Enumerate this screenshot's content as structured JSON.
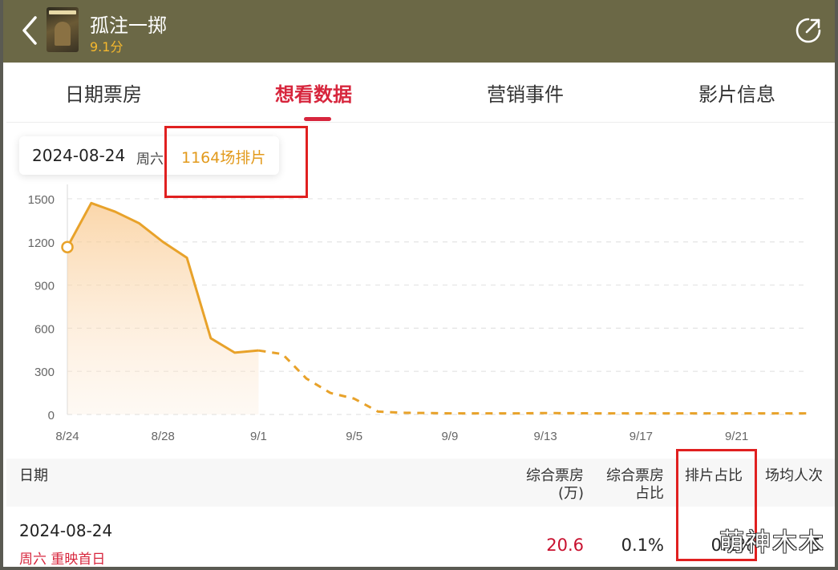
{
  "header": {
    "back_icon": "chevron-left-icon",
    "movie_title": "孤注一掷",
    "movie_score": "9.1分",
    "share_icon": "share-icon",
    "bg_color": "#6b6846",
    "score_color": "#f5b82e"
  },
  "tabs": [
    {
      "label": "日期票房",
      "active": false
    },
    {
      "label": "想看数据",
      "active": true
    },
    {
      "label": "营销事件",
      "active": false
    },
    {
      "label": "影片信息",
      "active": false
    }
  ],
  "tooltip": {
    "date": "2024-08-24",
    "weekday": "周六",
    "shows": "1164场排片"
  },
  "chart_data": {
    "type": "area",
    "title": "",
    "xlabel": "",
    "ylabel": "",
    "ylim": [
      0,
      1600
    ],
    "yticks": [
      0,
      300,
      600,
      900,
      1200,
      1500
    ],
    "x_tick_labels": [
      "8/24",
      "8/28",
      "9/1",
      "9/5",
      "9/9",
      "9/13",
      "9/17",
      "9/21"
    ],
    "x": [
      "8/24",
      "8/25",
      "8/26",
      "8/27",
      "8/28",
      "8/29",
      "8/30",
      "8/31",
      "9/1",
      "9/2",
      "9/3",
      "9/4",
      "9/5",
      "9/6",
      "9/7",
      "9/8",
      "9/9",
      "9/10",
      "9/11",
      "9/12",
      "9/13",
      "9/14",
      "9/15",
      "9/16",
      "9/17",
      "9/18",
      "9/19",
      "9/20",
      "9/21",
      "9/22",
      "9/23",
      "9/24"
    ],
    "series": [
      {
        "values": [
          1164,
          1470,
          1410,
          1330,
          1200,
          1090,
          530,
          430,
          445,
          420,
          250,
          150,
          110,
          20,
          12,
          10,
          8,
          8,
          8,
          8,
          10,
          9,
          8,
          8,
          8,
          8,
          8,
          8,
          8,
          8,
          8,
          8
        ],
        "actual_until": "9/1"
      }
    ],
    "selected_point": {
      "x": "8/24",
      "y": 1164
    },
    "grid": true,
    "line_color": "#e8a22a"
  },
  "table": {
    "headers": {
      "date": "日期",
      "box_office_line1": "综合票房",
      "box_office_line2": "(万)",
      "share_line1": "综合票房",
      "share_line2": "占比",
      "schedule_share": "排片占比",
      "avg_per_show": "场均人次"
    },
    "rows": [
      {
        "date": "2024-08-24",
        "sub": "周六  重映首日",
        "box_office": "20.6",
        "share": "0.1%",
        "schedule_share": "0.1%",
        "avg_per_show": "5"
      }
    ]
  },
  "watermark": "萌神木木"
}
